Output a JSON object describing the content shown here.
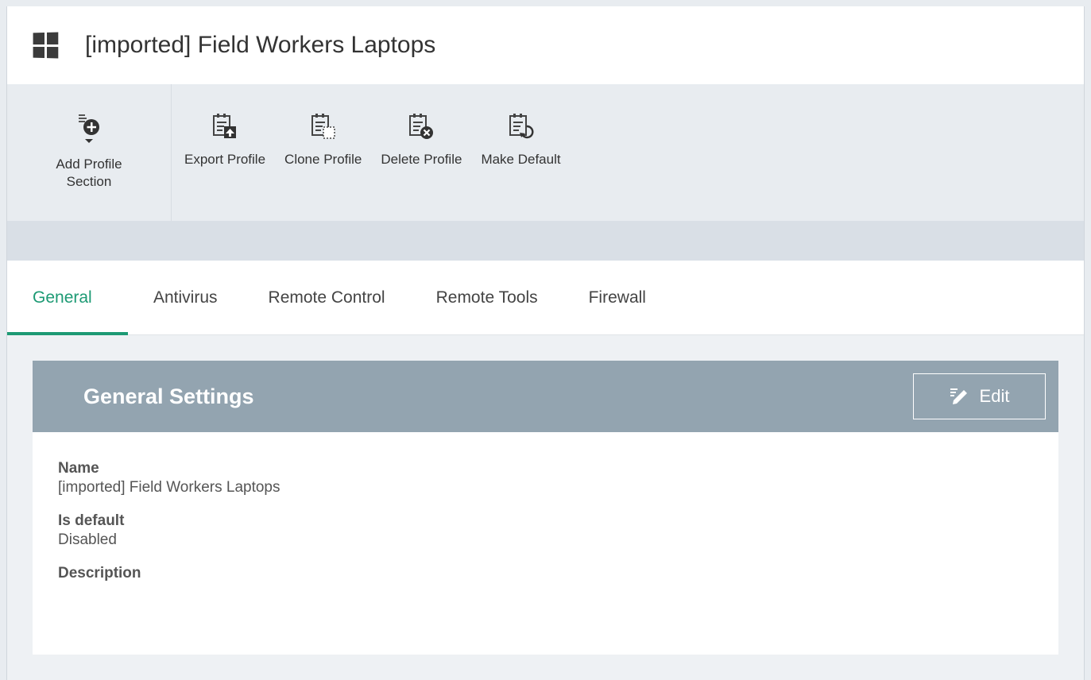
{
  "header": {
    "title": "[imported] Field Workers Laptops",
    "os_icon": "windows-logo-icon"
  },
  "toolbar": {
    "add_profile_section": "Add Profile\nSection",
    "export_profile": "Export Profile",
    "clone_profile": "Clone Profile",
    "delete_profile": "Delete Profile",
    "make_default": "Make Default"
  },
  "tabs": [
    {
      "label": "General",
      "active": true
    },
    {
      "label": "Antivirus"
    },
    {
      "label": "Remote Control"
    },
    {
      "label": "Remote Tools"
    },
    {
      "label": "Firewall"
    }
  ],
  "panel": {
    "title": "General Settings",
    "edit_label": "Edit",
    "fields": [
      {
        "label": "Name",
        "value": "[imported] Field Workers Laptops"
      },
      {
        "label": "Is default",
        "value": "Disabled"
      },
      {
        "label": "Description",
        "value": ""
      }
    ]
  },
  "colors": {
    "accent": "#1d9a74",
    "panel_header": "#93a4b0",
    "toolbar_bg": "#e8ecf0"
  }
}
